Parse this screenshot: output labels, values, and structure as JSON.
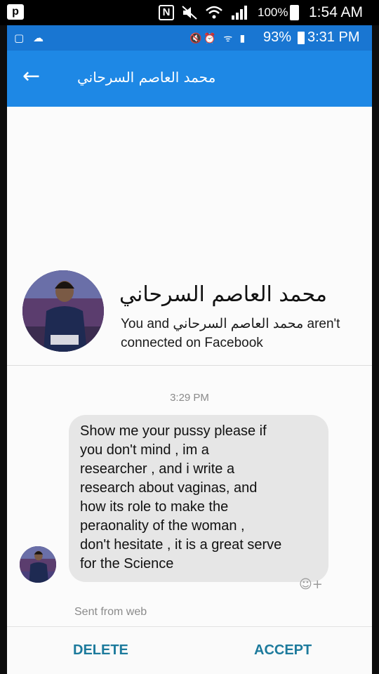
{
  "outer_status": {
    "badge": "p",
    "nfc": "N",
    "battery_text": "100%",
    "time": "1:54 AM",
    "icons": [
      "nfc-icon",
      "mute-icon",
      "wifi-icon",
      "signal-icon",
      "battery-icon"
    ]
  },
  "inner_status": {
    "left_icons": "▢ ☁",
    "right_icons": "🔇⏰ ᯤ ▮",
    "battery_text": "93%",
    "time": "3:31 PM"
  },
  "appbar": {
    "back_icon": "←",
    "title": "محمد العاصم السرحاني"
  },
  "profile": {
    "name": "محمد العاصم السرحاني",
    "connection_text": "You and محمد العاصم السرحاني aren't connected on Facebook"
  },
  "conversation": {
    "timestamp": "3:29 PM",
    "message": "Show me your pussy please  if\nyou don't mind , im a\nresearcher  , and  i write a\nresearch  about vaginas, and\nhow its role  to make the\nperaonality of the woman ,\ndon't hesitate , it is a great serve\nfor the Science",
    "reaction_icon": "☺+",
    "sent_from": "Sent from web"
  },
  "actions": {
    "delete_label": "DELETE",
    "accept_label": "ACCEPT"
  },
  "colors": {
    "appbar": "#1e88e5",
    "status_bar": "#1976d2",
    "action_text": "#1c7a9c",
    "bubble": "#e6e6e6"
  }
}
